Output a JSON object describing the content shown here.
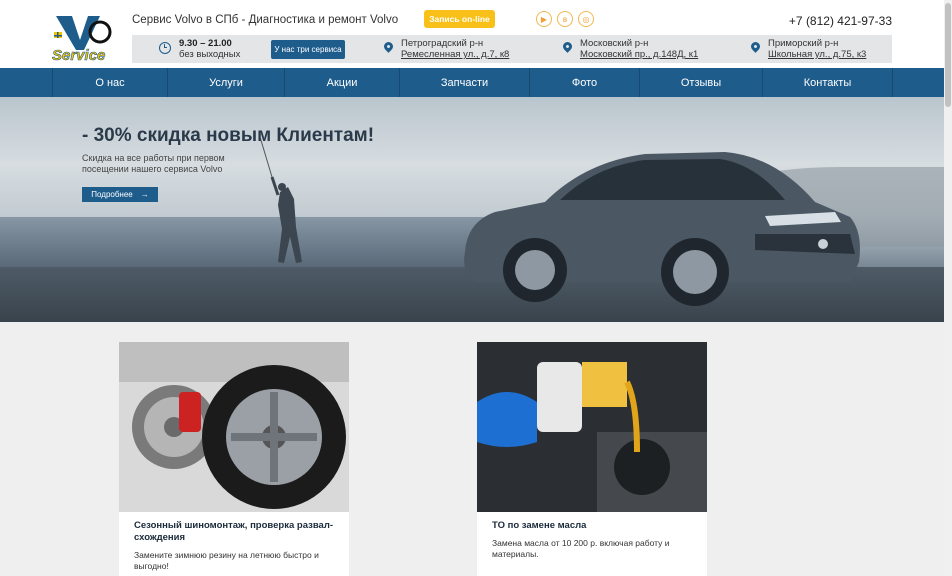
{
  "header": {
    "site_title": "Сервис Volvo в СПб - Диагностика и ремонт Volvo",
    "online_button": "Запись on-line",
    "phone": "+7 (812) 421-97-33",
    "socials": [
      "youtube-icon",
      "vk-icon",
      "instagram-icon"
    ]
  },
  "infobar": {
    "hours_time": "9.30 – 21.00",
    "hours_days": "без выходных",
    "three_services_button": "У нас три сервиса",
    "locations": [
      {
        "district": "Петроградский р-н",
        "address": "Ремесленная ул., д.7, к8"
      },
      {
        "district": "Московский р-н",
        "address": "Московский пр., д.148Д, к1"
      },
      {
        "district": "Приморский р-н",
        "address": "Школьная ул., д.75, к3"
      }
    ]
  },
  "nav": {
    "items": [
      "О нас",
      "Услуги",
      "Акции",
      "Запчасти",
      "Фото",
      "Отзывы",
      "Контакты"
    ]
  },
  "hero": {
    "title": "- 30% скидка новым Клиентам!",
    "subtitle": "Скидка на все работы при первом посещении нашего сервиса Volvo",
    "button": "Подробнее"
  },
  "cards": [
    {
      "title": "Сезонный шиномонтаж, проверка развал-схождения",
      "desc": "Замените зимнюю резину на летнюю быстро и выгодно!"
    },
    {
      "title": "ТО по замене масла",
      "desc": "Замена масла от 10 200 р. включая работу и материалы."
    }
  ],
  "colors": {
    "brand_blue": "#1e5c8c",
    "accent_yellow": "#f8c018"
  }
}
